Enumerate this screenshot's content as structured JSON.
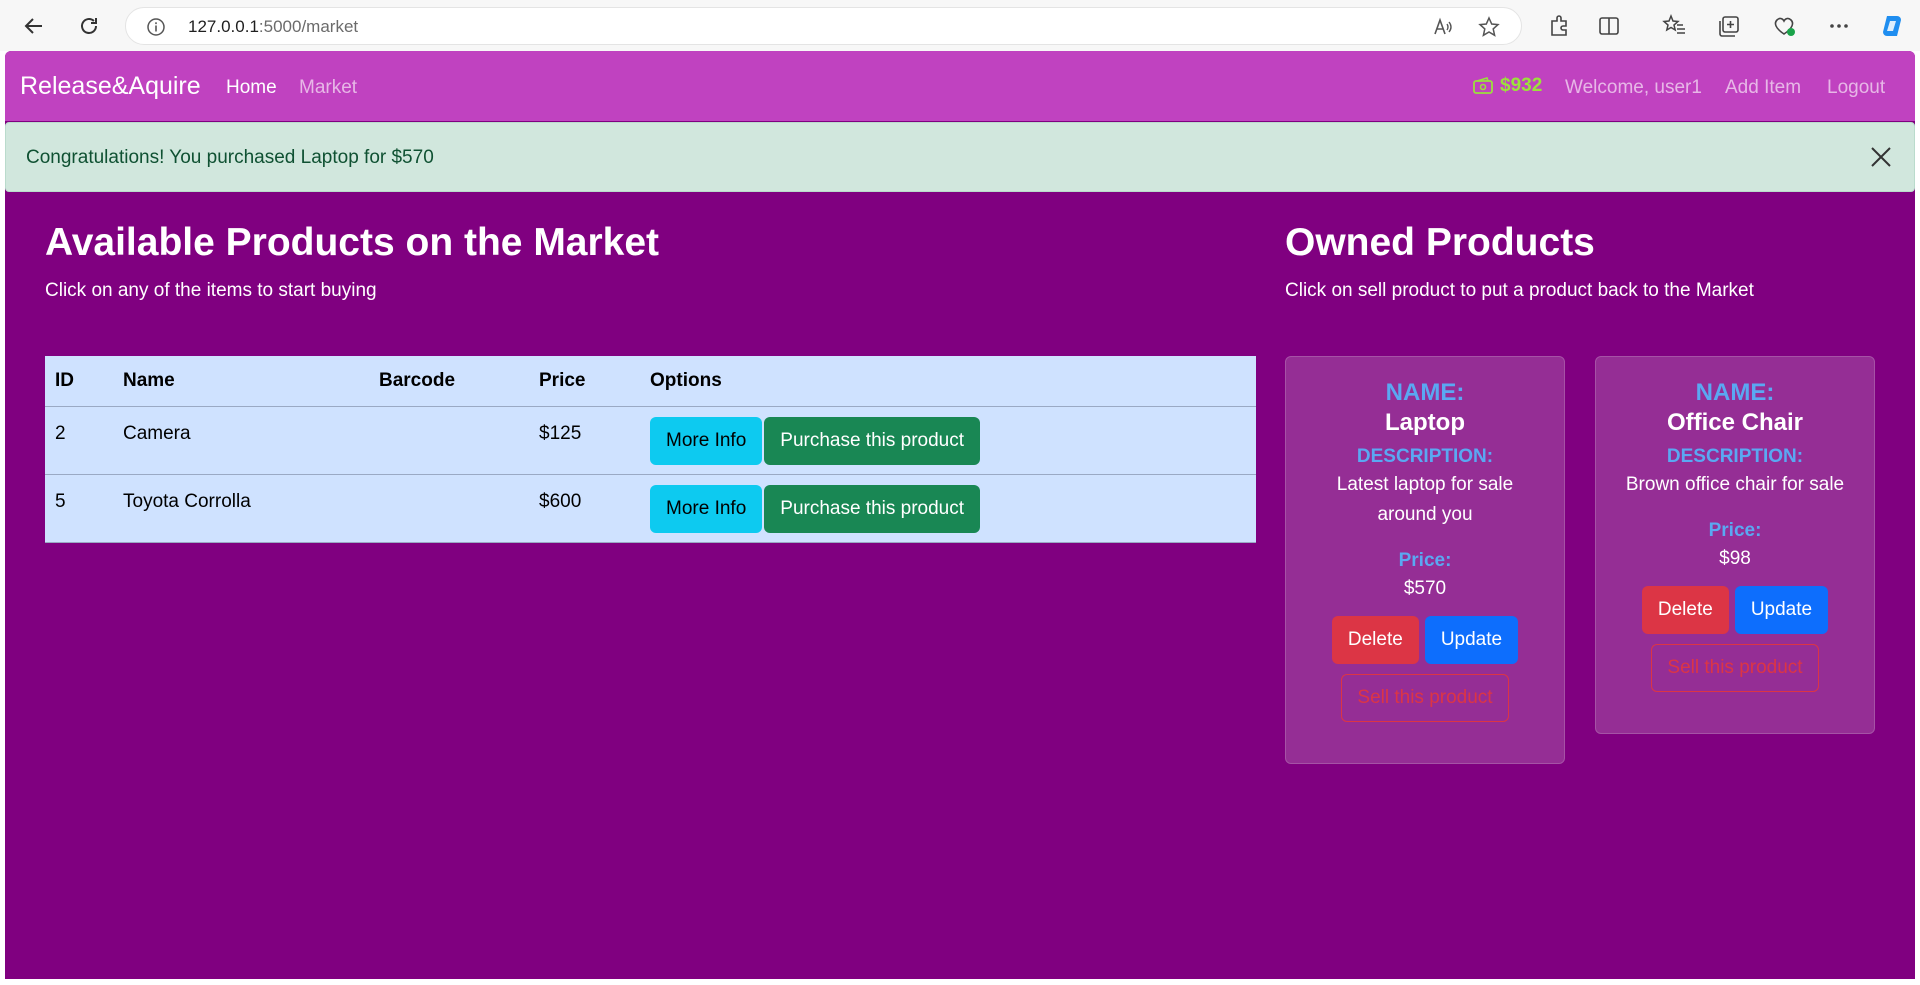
{
  "browser": {
    "url_host": "127.0.0.1",
    "url_path": ":5000/market"
  },
  "navbar": {
    "brand": "Release&Aquire",
    "home_label": "Home",
    "market_label": "Market",
    "budget": "$932",
    "welcome": "Welcome, user1",
    "add_item_label": "Add Item",
    "logout_label": "Logout"
  },
  "alert": {
    "message": "Congratulations! You purchased Laptop for $570"
  },
  "market": {
    "heading": "Available Products on the Market",
    "subtext": "Click on any of the items to start buying",
    "columns": [
      "ID",
      "Name",
      "Barcode",
      "Price",
      "Options"
    ],
    "rows": [
      {
        "id": "2",
        "name": "Camera",
        "barcode": "",
        "price": "$125",
        "more_info_label": "More Info",
        "purchase_label": "Purchase this product"
      },
      {
        "id": "5",
        "name": "Toyota Corrolla",
        "barcode": "",
        "price": "$600",
        "more_info_label": "More Info",
        "purchase_label": "Purchase this product"
      }
    ]
  },
  "owned": {
    "heading": "Owned Products",
    "subtext": "Click on sell product to put a product back to the Market",
    "items": [
      {
        "name_label": "NAME:",
        "name": "Laptop",
        "description_label": "DESCRIPTION:",
        "description": "Latest laptop for sale around you",
        "price_label": "Price:",
        "price": "$570",
        "delete_label": "Delete",
        "update_label": "Update",
        "sell_label": "Sell this product"
      },
      {
        "name_label": "NAME:",
        "name": "Office Chair",
        "description_label": "DESCRIPTION:",
        "description": "Brown office chair for sale",
        "price_label": "Price:",
        "price": "$98",
        "delete_label": "Delete",
        "update_label": "Update",
        "sell_label": "Sell this product"
      }
    ]
  },
  "colors": {
    "page_bg": "#800080",
    "navbar_bg": "#c042c0",
    "alert_bg": "#d1e7dd",
    "table_bg": "#cfe2ff",
    "card_bg": "#952e95",
    "budget_color": "#9be03c"
  }
}
